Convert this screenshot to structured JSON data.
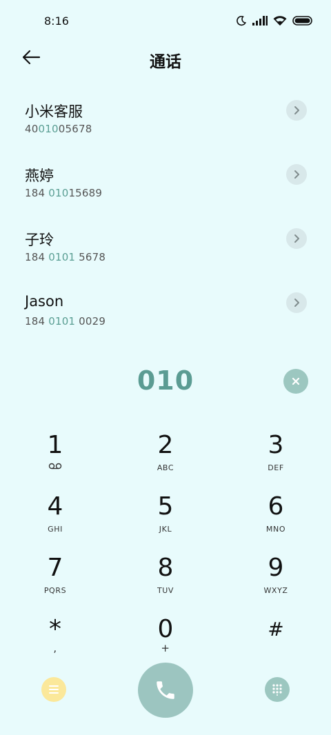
{
  "status_bar": {
    "time": "8:16",
    "icons": [
      "moon-icon",
      "signal-icon",
      "wifi-icon",
      "battery-icon"
    ]
  },
  "header": {
    "title": "通话",
    "back_icon": "arrow-left-icon"
  },
  "contacts": [
    {
      "name": "小米客服",
      "number_pre": "40",
      "number_match": "010",
      "number_post": "05678"
    },
    {
      "name": "燕婷",
      "number_pre": "184 ",
      "number_match": "010",
      "number_post": "15689"
    },
    {
      "name": "子玲",
      "number_pre": "184 ",
      "number_match": "0101",
      "number_post": " 5678"
    },
    {
      "name": "Jason",
      "number_pre": "184 ",
      "number_match": "0101",
      "number_post": " 0029"
    }
  ],
  "dialed": "010",
  "keypad": {
    "k1": {
      "digit": "1",
      "letters": ""
    },
    "k2": {
      "digit": "2",
      "letters": "ABC"
    },
    "k3": {
      "digit": "3",
      "letters": "DEF"
    },
    "k4": {
      "digit": "4",
      "letters": "GHI"
    },
    "k5": {
      "digit": "5",
      "letters": "JKL"
    },
    "k6": {
      "digit": "6",
      "letters": "MNO"
    },
    "k7": {
      "digit": "7",
      "letters": "PQRS"
    },
    "k8": {
      "digit": "8",
      "letters": "TUV"
    },
    "k9": {
      "digit": "9",
      "letters": "WXYZ"
    },
    "star": {
      "digit": "*",
      "letters": ","
    },
    "k0": {
      "digit": "0",
      "letters": "+"
    },
    "hash": {
      "digit": "#",
      "letters": ""
    }
  },
  "colors": {
    "background": "#e8fbfc",
    "accent": "#5b9c93",
    "call_button": "#9cc5c0",
    "menu_button": "#fbe89a"
  }
}
